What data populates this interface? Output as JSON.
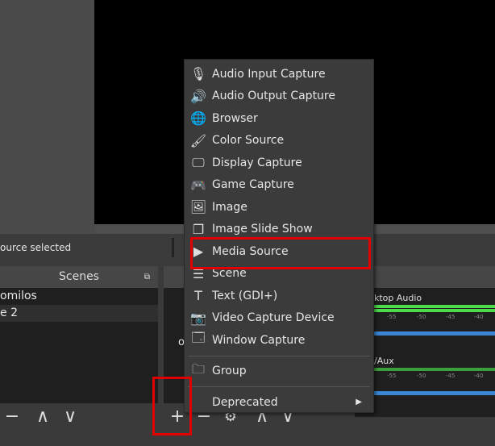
{
  "status": {
    "text": "ource selected"
  },
  "scenes": {
    "title": "Scenes",
    "items": [
      {
        "label": "omilos",
        "selected": false
      },
      {
        "label": "e 2",
        "selected": true
      }
    ],
    "tools": {
      "remove": "−",
      "up": "∧",
      "down": "∨"
    }
  },
  "sources": {
    "partial_text": "o",
    "tools": {
      "add": "+",
      "remove": "−",
      "settings": "⚙",
      "up": "∧",
      "down": "∨"
    }
  },
  "mixer": {
    "channels": [
      {
        "label": "ktop Audio",
        "ticks": [
          "-55",
          "-50",
          "-45",
          "-40"
        ]
      },
      {
        "label": "/Aux",
        "ticks": [
          "-55",
          "-50",
          "-45",
          "-40"
        ]
      }
    ]
  },
  "menu": {
    "items": [
      {
        "label": "Audio Input Capture",
        "icon": "microphone-icon",
        "glyph": "🎙"
      },
      {
        "label": "Audio Output Capture",
        "icon": "speaker-icon",
        "glyph": "🔊"
      },
      {
        "label": "Browser",
        "icon": "globe-icon",
        "glyph": "🌐"
      },
      {
        "label": "Color Source",
        "icon": "paintbrush-icon",
        "glyph": "🖌"
      },
      {
        "label": "Display Capture",
        "icon": "monitor-icon",
        "glyph": "🖵"
      },
      {
        "label": "Game Capture",
        "icon": "gamepad-icon",
        "glyph": "🎮"
      },
      {
        "label": "Image",
        "icon": "image-icon",
        "glyph": "🖼"
      },
      {
        "label": "Image Slide Show",
        "icon": "slideshow-icon",
        "glyph": "❐"
      },
      {
        "label": "Media Source",
        "icon": "play-icon",
        "glyph": "▶"
      },
      {
        "label": "Scene",
        "icon": "list-icon",
        "glyph": "☰"
      },
      {
        "label": "Text (GDI+)",
        "icon": "text-icon",
        "glyph": "T"
      },
      {
        "label": "Video Capture Device",
        "icon": "camera-icon",
        "glyph": "📷"
      },
      {
        "label": "Window Capture",
        "icon": "window-icon",
        "glyph": "🗔"
      }
    ],
    "group": {
      "label": "Group",
      "icon": "folder-icon",
      "glyph": "🗀"
    },
    "deprecated": {
      "label": "Deprecated",
      "arrow": "▶"
    }
  },
  "highlight_color": "#e00000"
}
